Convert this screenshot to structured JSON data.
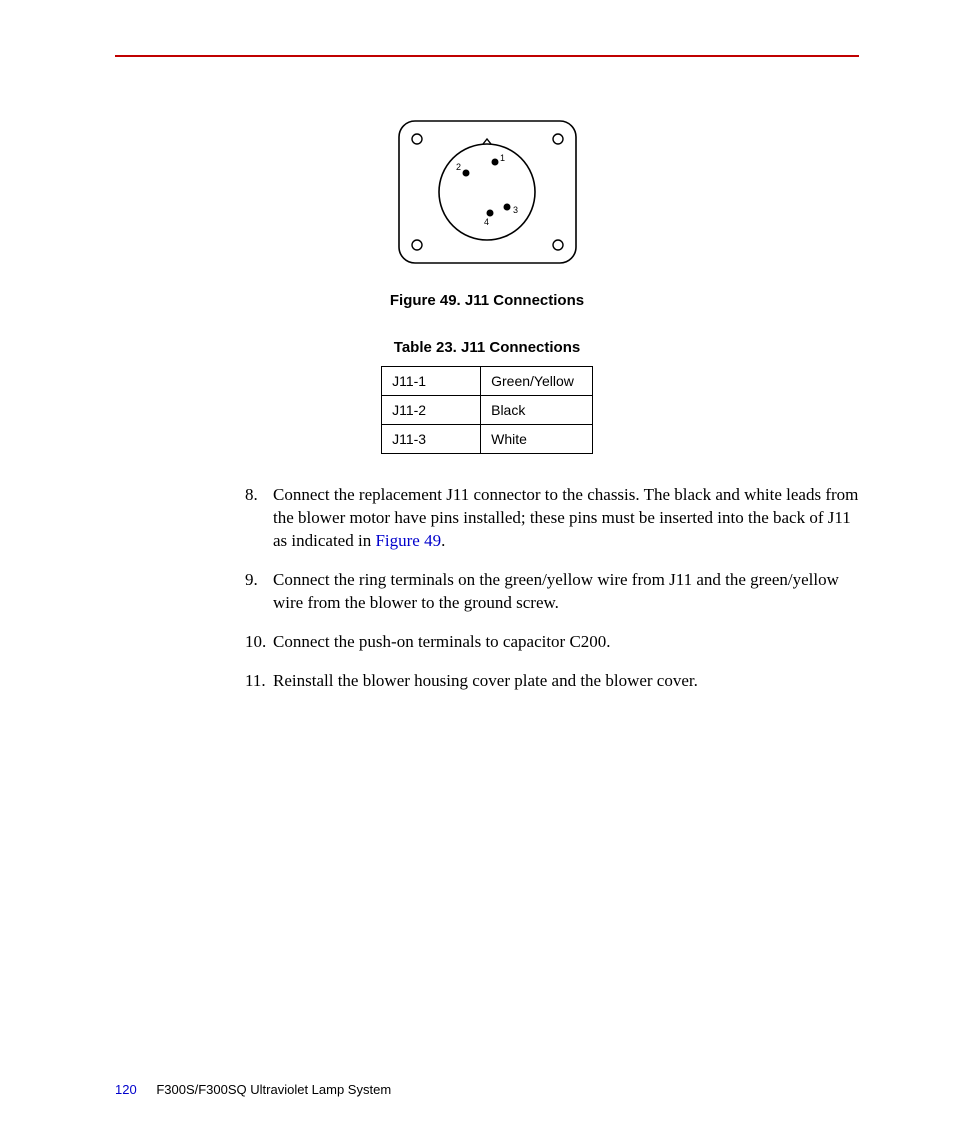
{
  "figure": {
    "caption": "Figure 49. J11 Connections",
    "pins": {
      "p1": "1",
      "p2": "2",
      "p3": "3",
      "p4": "4"
    }
  },
  "table": {
    "caption": "Table 23. J11 Connections",
    "rows": [
      {
        "pin": "J11-1",
        "color": "Green/Yellow"
      },
      {
        "pin": "J11-2",
        "color": "Black"
      },
      {
        "pin": "J11-3",
        "color": "White"
      }
    ]
  },
  "steps": {
    "s8_num": "8.",
    "s8_a": "Connect the replacement J11 connector to the chassis. The black and white leads from the blower motor have pins installed; these pins must be inserted into the back of J11 as indicated in ",
    "s8_link": "Figure 49",
    "s8_b": ".",
    "s9_num": "9.",
    "s9": "Connect the ring terminals on the green/yellow wire from J11 and the green/yellow wire from the blower to the ground screw.",
    "s10_num": "10.",
    "s10": " Connect the push-on terminals to capacitor C200.",
    "s11_num": "11.",
    "s11": "Reinstall the blower housing cover plate and the blower cover."
  },
  "footer": {
    "page": "120",
    "title": "F300S/F300SQ Ultraviolet Lamp System"
  }
}
